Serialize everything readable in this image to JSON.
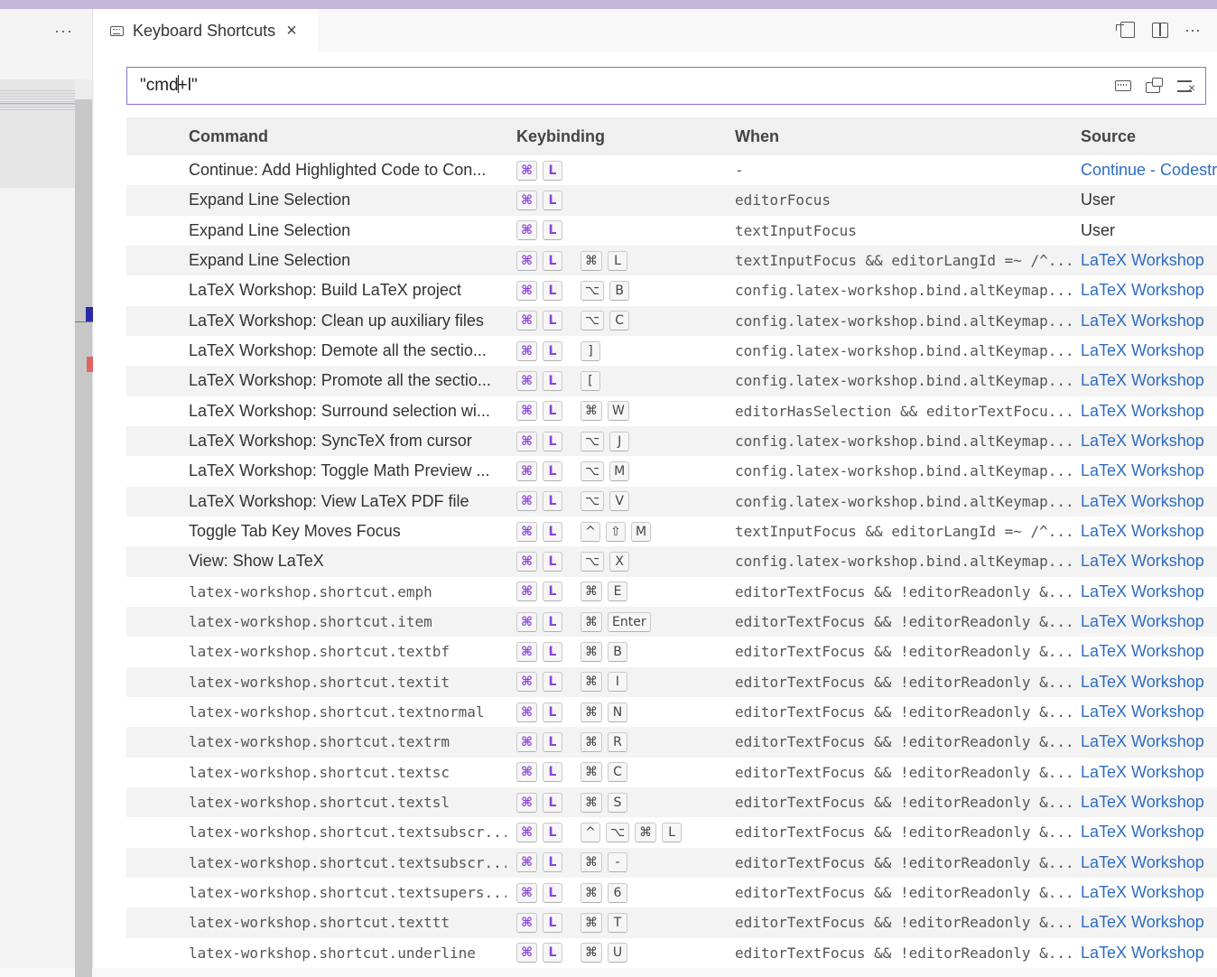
{
  "tab": {
    "title": "Keyboard Shortcuts",
    "close": "×"
  },
  "left": {
    "dots": "···"
  },
  "actions": {
    "more": "···"
  },
  "search": {
    "value_before": "\"cmd",
    "value_after": "+l\""
  },
  "headers": {
    "command": "Command",
    "keybinding": "Keybinding",
    "when": "When",
    "source": "Source"
  },
  "accent_color": "#8b45d6",
  "link_color": "#2f6cc1",
  "rows": [
    {
      "command": "Continue: Add Highlighted Code to Con...",
      "mono": false,
      "keys": [
        [
          "⌘",
          "L"
        ]
      ],
      "when": "-",
      "source": "Continue - Codestral, Claude, and more",
      "ext": true
    },
    {
      "command": "Expand Line Selection",
      "mono": false,
      "keys": [
        [
          "⌘",
          "L"
        ]
      ],
      "when": "editorFocus",
      "source": "User",
      "ext": false
    },
    {
      "command": "Expand Line Selection",
      "mono": false,
      "keys": [
        [
          "⌘",
          "L"
        ]
      ],
      "when": "textInputFocus",
      "source": "User",
      "ext": false
    },
    {
      "command": "Expand Line Selection",
      "mono": false,
      "keys": [
        [
          "⌘",
          "L"
        ],
        [
          "⌘",
          "L"
        ]
      ],
      "when": "textInputFocus && editorLangId =~ /^...",
      "source": "LaTeX Workshop",
      "ext": true
    },
    {
      "command": "LaTeX Workshop: Build LaTeX project",
      "mono": false,
      "keys": [
        [
          "⌘",
          "L"
        ],
        [
          "⌥",
          "B"
        ]
      ],
      "when": "config.latex-workshop.bind.altKeymap...",
      "source": "LaTeX Workshop",
      "ext": true
    },
    {
      "command": "LaTeX Workshop: Clean up auxiliary files",
      "mono": false,
      "keys": [
        [
          "⌘",
          "L"
        ],
        [
          "⌥",
          "C"
        ]
      ],
      "when": "config.latex-workshop.bind.altKeymap...",
      "source": "LaTeX Workshop",
      "ext": true
    },
    {
      "command": "LaTeX Workshop: Demote all the sectio...",
      "mono": false,
      "keys": [
        [
          "⌘",
          "L"
        ],
        [
          "]"
        ]
      ],
      "when": "config.latex-workshop.bind.altKeymap...",
      "source": "LaTeX Workshop",
      "ext": true
    },
    {
      "command": "LaTeX Workshop: Promote all the sectio...",
      "mono": false,
      "keys": [
        [
          "⌘",
          "L"
        ],
        [
          "["
        ]
      ],
      "when": "config.latex-workshop.bind.altKeymap...",
      "source": "LaTeX Workshop",
      "ext": true
    },
    {
      "command": "LaTeX Workshop: Surround selection wi...",
      "mono": false,
      "keys": [
        [
          "⌘",
          "L"
        ],
        [
          "⌘",
          "W"
        ]
      ],
      "when": "editorHasSelection && editorTextFocu...",
      "source": "LaTeX Workshop",
      "ext": true
    },
    {
      "command": "LaTeX Workshop: SyncTeX from cursor",
      "mono": false,
      "keys": [
        [
          "⌘",
          "L"
        ],
        [
          "⌥",
          "J"
        ]
      ],
      "when": "config.latex-workshop.bind.altKeymap...",
      "source": "LaTeX Workshop",
      "ext": true
    },
    {
      "command": "LaTeX Workshop: Toggle Math Preview ...",
      "mono": false,
      "keys": [
        [
          "⌘",
          "L"
        ],
        [
          "⌥",
          "M"
        ]
      ],
      "when": "config.latex-workshop.bind.altKeymap...",
      "source": "LaTeX Workshop",
      "ext": true
    },
    {
      "command": "LaTeX Workshop: View LaTeX PDF file",
      "mono": false,
      "keys": [
        [
          "⌘",
          "L"
        ],
        [
          "⌥",
          "V"
        ]
      ],
      "when": "config.latex-workshop.bind.altKeymap...",
      "source": "LaTeX Workshop",
      "ext": true
    },
    {
      "command": "Toggle Tab Key Moves Focus",
      "mono": false,
      "keys": [
        [
          "⌘",
          "L"
        ],
        [
          "^",
          "⇧",
          "M"
        ]
      ],
      "when": "textInputFocus && editorLangId =~ /^...",
      "source": "LaTeX Workshop",
      "ext": true
    },
    {
      "command": "View: Show LaTeX",
      "mono": false,
      "keys": [
        [
          "⌘",
          "L"
        ],
        [
          "⌥",
          "X"
        ]
      ],
      "when": "config.latex-workshop.bind.altKeymap...",
      "source": "LaTeX Workshop",
      "ext": true
    },
    {
      "command": "latex-workshop.shortcut.emph",
      "mono": true,
      "keys": [
        [
          "⌘",
          "L"
        ],
        [
          "⌘",
          "E"
        ]
      ],
      "when": "editorTextFocus && !editorReadonly &...",
      "source": "LaTeX Workshop",
      "ext": true
    },
    {
      "command": "latex-workshop.shortcut.item",
      "mono": true,
      "keys": [
        [
          "⌘",
          "L"
        ],
        [
          "⌘",
          "Enter"
        ]
      ],
      "when": "editorTextFocus && !editorReadonly &...",
      "source": "LaTeX Workshop",
      "ext": true
    },
    {
      "command": "latex-workshop.shortcut.textbf",
      "mono": true,
      "keys": [
        [
          "⌘",
          "L"
        ],
        [
          "⌘",
          "B"
        ]
      ],
      "when": "editorTextFocus && !editorReadonly &...",
      "source": "LaTeX Workshop",
      "ext": true
    },
    {
      "command": "latex-workshop.shortcut.textit",
      "mono": true,
      "keys": [
        [
          "⌘",
          "L"
        ],
        [
          "⌘",
          "I"
        ]
      ],
      "when": "editorTextFocus && !editorReadonly &...",
      "source": "LaTeX Workshop",
      "ext": true
    },
    {
      "command": "latex-workshop.shortcut.textnormal",
      "mono": true,
      "keys": [
        [
          "⌘",
          "L"
        ],
        [
          "⌘",
          "N"
        ]
      ],
      "when": "editorTextFocus && !editorReadonly &...",
      "source": "LaTeX Workshop",
      "ext": true
    },
    {
      "command": "latex-workshop.shortcut.textrm",
      "mono": true,
      "keys": [
        [
          "⌘",
          "L"
        ],
        [
          "⌘",
          "R"
        ]
      ],
      "when": "editorTextFocus && !editorReadonly &...",
      "source": "LaTeX Workshop",
      "ext": true
    },
    {
      "command": "latex-workshop.shortcut.textsc",
      "mono": true,
      "keys": [
        [
          "⌘",
          "L"
        ],
        [
          "⌘",
          "C"
        ]
      ],
      "when": "editorTextFocus && !editorReadonly &...",
      "source": "LaTeX Workshop",
      "ext": true
    },
    {
      "command": "latex-workshop.shortcut.textsl",
      "mono": true,
      "keys": [
        [
          "⌘",
          "L"
        ],
        [
          "⌘",
          "S"
        ]
      ],
      "when": "editorTextFocus && !editorReadonly &...",
      "source": "LaTeX Workshop",
      "ext": true
    },
    {
      "command": "latex-workshop.shortcut.textsubscr...",
      "mono": true,
      "keys": [
        [
          "⌘",
          "L"
        ],
        [
          "^",
          "⌥",
          "⌘",
          "L"
        ]
      ],
      "when": "editorTextFocus && !editorReadonly &...",
      "source": "LaTeX Workshop",
      "ext": true
    },
    {
      "command": "latex-workshop.shortcut.textsubscr...",
      "mono": true,
      "keys": [
        [
          "⌘",
          "L"
        ],
        [
          "⌘",
          "-"
        ]
      ],
      "when": "editorTextFocus && !editorReadonly &...",
      "source": "LaTeX Workshop",
      "ext": true
    },
    {
      "command": "latex-workshop.shortcut.textsupers...",
      "mono": true,
      "keys": [
        [
          "⌘",
          "L"
        ],
        [
          "⌘",
          "6"
        ]
      ],
      "when": "editorTextFocus && !editorReadonly &...",
      "source": "LaTeX Workshop",
      "ext": true
    },
    {
      "command": "latex-workshop.shortcut.texttt",
      "mono": true,
      "keys": [
        [
          "⌘",
          "L"
        ],
        [
          "⌘",
          "T"
        ]
      ],
      "when": "editorTextFocus && !editorReadonly &...",
      "source": "LaTeX Workshop",
      "ext": true
    },
    {
      "command": "latex-workshop.shortcut.underline",
      "mono": true,
      "keys": [
        [
          "⌘",
          "L"
        ],
        [
          "⌘",
          "U"
        ]
      ],
      "when": "editorTextFocus && !editorReadonly &...",
      "source": "LaTeX Workshop",
      "ext": true
    }
  ]
}
